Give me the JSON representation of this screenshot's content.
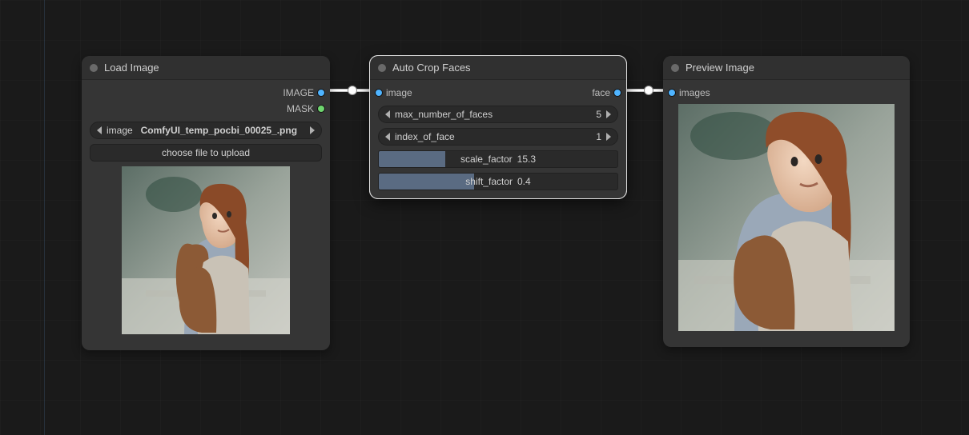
{
  "nodes": {
    "load": {
      "title": "Load Image",
      "outputs": {
        "image": "IMAGE",
        "mask": "MASK"
      },
      "combo": {
        "label": "image",
        "value": "ComfyUI_temp_pocbi_00025_.png"
      },
      "upload_button": "choose file to upload"
    },
    "crop": {
      "title": "Auto Crop Faces",
      "inputs": {
        "image": "image"
      },
      "outputs": {
        "face": "face"
      },
      "params": {
        "max_faces": {
          "label": "max_number_of_faces",
          "value": "5"
        },
        "index": {
          "label": "index_of_face",
          "value": "1"
        },
        "scale": {
          "label": "scale_factor",
          "value": "15.3"
        },
        "shift": {
          "label": "shift_factor",
          "value": "0.4"
        }
      }
    },
    "preview": {
      "title": "Preview Image",
      "inputs": {
        "images": "images"
      }
    }
  }
}
